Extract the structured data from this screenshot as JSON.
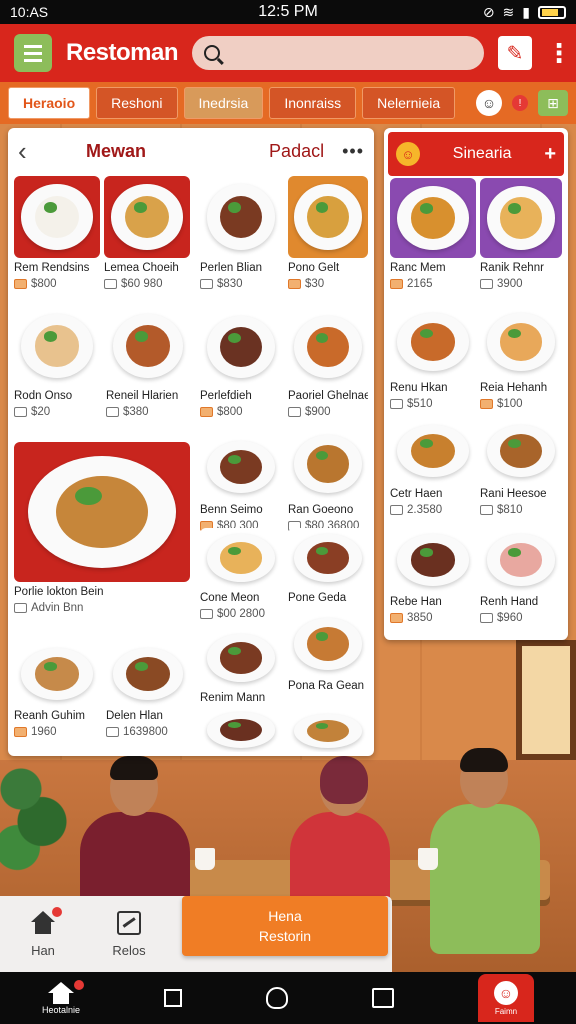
{
  "status": {
    "left": "10:AS",
    "time": "12:5 PM"
  },
  "app": {
    "title": "Restoman",
    "search_placeholder": ""
  },
  "tabs": [
    "Heraoio",
    "Reshoni",
    "Inedrsia",
    "Inonraiss",
    "Nelernieia"
  ],
  "tab_icons": {
    "badge_count": "!"
  },
  "menu_panel": {
    "title": "Mewan",
    "action": "Padacl",
    "items": [
      {
        "name": "Rem Rendsins",
        "price": "$800",
        "colors": [
          "#c8251e",
          "#f4f1ea"
        ]
      },
      {
        "name": "Lemea Choeih",
        "price": "$60 980",
        "colors": [
          "#c8251e",
          "#d9a24a"
        ]
      },
      {
        "name": "Perlen Blian",
        "price": "$830",
        "colors": [
          "#ffffff",
          "#7a3a22"
        ]
      },
      {
        "name": "Pono Gelt",
        "price": "$30",
        "colors": [
          "#e0892e",
          "#d8a03e"
        ]
      },
      {
        "name": "Rodn Onso",
        "price": "$20",
        "colors": [
          "#ffffff",
          "#e8c28e"
        ]
      },
      {
        "name": "Reneil Hlarien",
        "price": "$380",
        "colors": [
          "#ffffff",
          "#b35a2a"
        ]
      },
      {
        "name": "Perlefdieh",
        "price": "$800",
        "colors": [
          "#ffffff",
          "#6a3222"
        ]
      },
      {
        "name": "Paoriel Ghelnaee",
        "price": "$900",
        "colors": [
          "#ffffff",
          "#c96a2a"
        ]
      },
      {
        "name": "Porlie lokton Bein",
        "price": "Advin Bnn",
        "colors": [
          "#c8251e",
          "#c6863a"
        ]
      },
      {
        "name": "Benn Seimo",
        "price": "$80 300",
        "colors": [
          "#ffffff",
          "#7a3a22"
        ]
      },
      {
        "name": "Ran Goeono",
        "price": "$80 36800",
        "colors": [
          "#ffffff",
          "#b9762f"
        ]
      },
      {
        "name": "Cone Meon",
        "price": "$00 2800",
        "colors": [
          "#ffffff",
          "#e8b25a"
        ]
      },
      {
        "name": "Pone Geda",
        "price": "",
        "colors": [
          "#ffffff",
          "#8a3e24"
        ]
      },
      {
        "name": "Renim Mann",
        "price": "",
        "colors": [
          "#ffffff",
          "#7a3a22"
        ]
      },
      {
        "name": "Pona Ra Gean",
        "price": "",
        "colors": [
          "#ffffff",
          "#c67a34"
        ]
      },
      {
        "name": "Reanh Guhim",
        "price": "1960",
        "colors": [
          "#ffffff",
          "#c68a4a"
        ]
      },
      {
        "name": "Delen Hlan",
        "price": "1639800",
        "colors": [
          "#ffffff",
          "#8a4a24"
        ]
      },
      {
        "name": "",
        "price": "",
        "colors": [
          "#ffffff",
          "#6a3020"
        ]
      },
      {
        "name": "",
        "price": "",
        "colors": [
          "#ffffff",
          "#c2823a"
        ]
      }
    ]
  },
  "side_panel": {
    "title": "Sinearia",
    "logo": "☺",
    "plus": "+",
    "items": [
      {
        "name": "Ranc Mem",
        "price": "2165",
        "colors": [
          "#8a4ab0",
          "#d8902e"
        ]
      },
      {
        "name": "Ranik Rehnr",
        "price": "3900",
        "colors": [
          "#8a4ab0",
          "#e8b25a"
        ]
      },
      {
        "name": "Renu Hkan",
        "price": "$510",
        "colors": [
          "#ffffff",
          "#c86a2a"
        ]
      },
      {
        "name": "Reia Hehanh",
        "price": "$100",
        "colors": [
          "#ffffff",
          "#e8a85a"
        ]
      },
      {
        "name": "Cetr Haen",
        "price": "2.3580",
        "colors": [
          "#ffffff",
          "#c8802e"
        ]
      },
      {
        "name": "Rani Heesoe",
        "price": "$810",
        "colors": [
          "#ffffff",
          "#a8642a"
        ]
      },
      {
        "name": "Rebe Han",
        "price": "3850",
        "colors": [
          "#ffffff",
          "#6a3020"
        ]
      },
      {
        "name": "Renh Hand",
        "price": "$960",
        "colors": [
          "#ffffff",
          "#e8a8a0"
        ]
      }
    ]
  },
  "bottom": {
    "home_label": "Han",
    "orders_label": "Relos",
    "cta_line1": "Hena",
    "cta_line2": "Restorin"
  },
  "sysnav": {
    "home_label": "Heotalnie",
    "brand_label": "Faimn"
  }
}
